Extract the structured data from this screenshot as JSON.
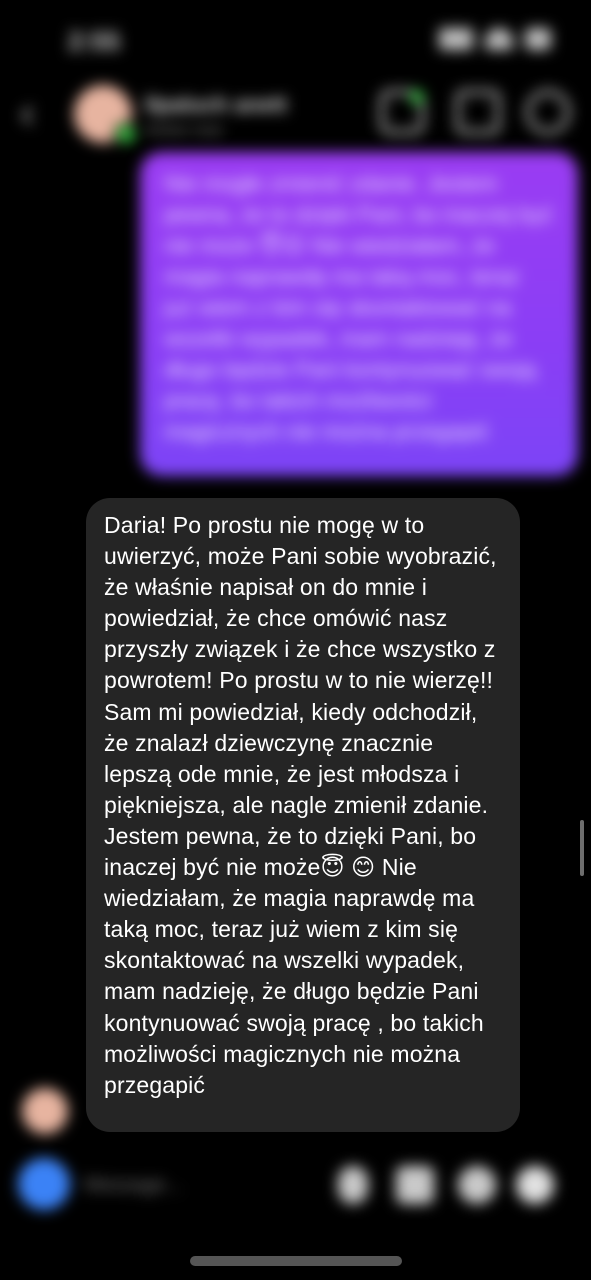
{
  "status_bar": {
    "time": "2:55"
  },
  "header": {
    "back_label": "‹",
    "contact_name": "Ilpaluch   anett",
    "contact_status": "Active now"
  },
  "outgoing_message": {
    "text": "Nie mogłe zmienić zdanie. Jestem pewna, że to dzięki Pani, bo inaczej być nie może 😇😊 Nie wiedziałam, że magia naprawdę ma taką moc, teraz już wiem z kim się skontaktować na wszelki wypadek, mam nadzieję, że długo będzie Pani kontynuować swoją pracę, bo takich możliwości magicznych nie można przegapić"
  },
  "incoming_message": {
    "text": "Daria! Po prostu nie mogę w to uwierzyć, może Pani sobie wyobrazić, że właśnie napisał on do mnie i powiedział, że chce omówić nasz przyszły związek i że chce wszystko z powrotem! Po prostu w to nie wierzę!! Sam mi powiedział, kiedy odchodził, że znalazł dziewczynę znacznie lepszą ode mnie, że jest młodsza i piękniejsza, ale nagle zmienił zdanie. Jestem pewna, że to dzięki Pani, bo inaczej być nie może😇 😊  Nie wiedziałam, że magia naprawdę ma taką moc, teraz już wiem z kim się skontaktować na wszelki wypadek, mam nadzieję, że długo będzie Pani kontynuować swoją pracę , bo takich możliwości magicznych nie można przegapić"
  },
  "composer": {
    "placeholder": "Message..."
  },
  "colors": {
    "outgoing_bubble": "#8a3ef5",
    "incoming_bubble": "#252525",
    "online": "#37c043",
    "camera": "#3b82f6"
  }
}
